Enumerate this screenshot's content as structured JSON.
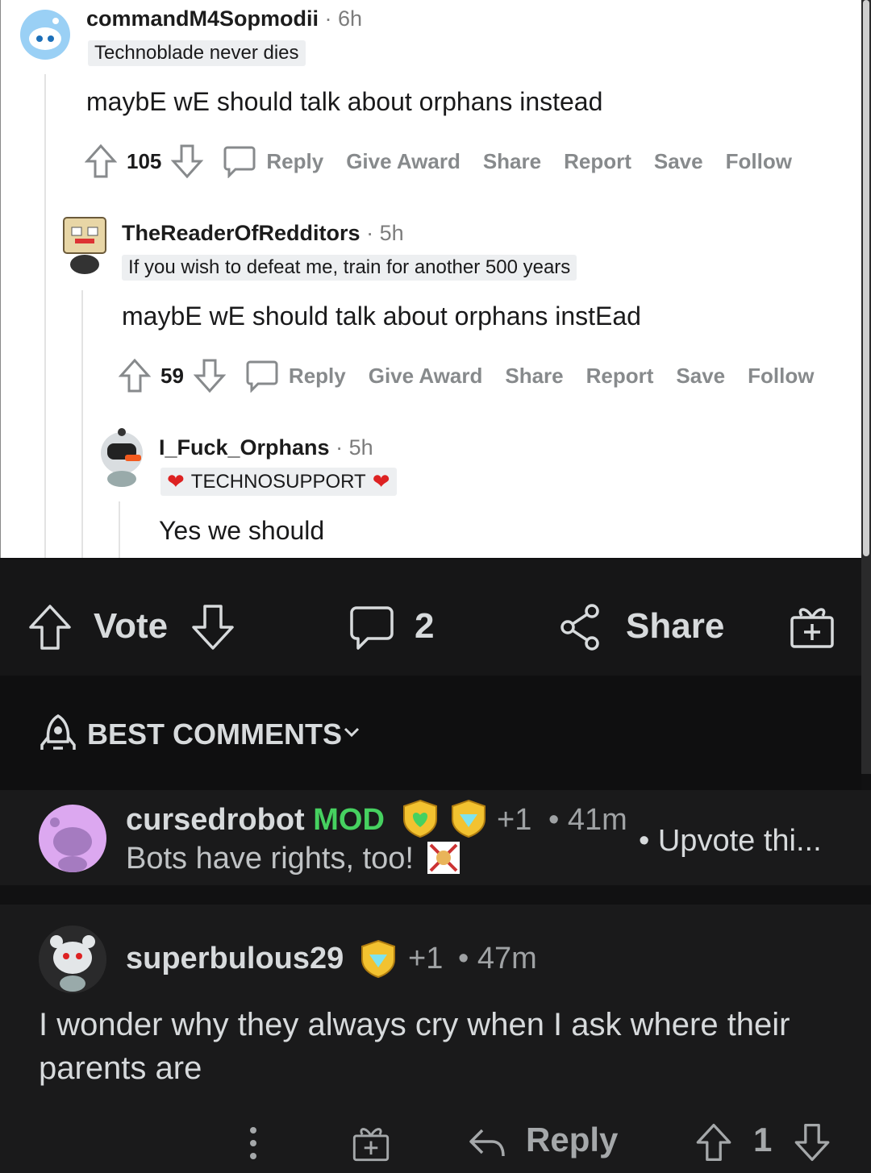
{
  "screenshot": {
    "comments": [
      {
        "username": "commandM4Sopmodii",
        "time": "· 6h",
        "flair": "Technoblade never dies",
        "text": "maybE wE should talk about orphans instead",
        "votes": "105"
      },
      {
        "username": "TheReaderOfRedditors",
        "time": "· 5h",
        "flair": "If you wish to defeat me, train for another 500 years",
        "text": "maybE wE should talk about orphans instEad",
        "votes": "59"
      },
      {
        "username": "I_Fuck_Orphans",
        "time": "· 5h",
        "flair": "TECHNOSUPPORT",
        "text": "Yes we should"
      }
    ],
    "actions": {
      "reply": "Reply",
      "give_award": "Give Award",
      "share": "Share",
      "report": "Report",
      "save": "Save",
      "follow": "Follow"
    }
  },
  "post_bar": {
    "vote_label": "Vote",
    "comment_count": "2",
    "share_label": "Share"
  },
  "sort": {
    "label": "BEST COMMENTS"
  },
  "comments": [
    {
      "username": "cursedrobot",
      "mod_label": "MOD",
      "awards": "+1",
      "time": "• 41m",
      "text": "Bots have rights, too!",
      "trailing": "• Upvote thi..."
    },
    {
      "username": "superbulous29",
      "awards": "+1",
      "time": "• 47m",
      "text": "I wonder why they always cry when I ask where their parents are",
      "reply_label": "Reply",
      "score": "1"
    }
  ],
  "colors": {
    "mod_green": "#46d160",
    "dark_bg": "#1a1a1b",
    "text_light": "#d7dadc"
  }
}
